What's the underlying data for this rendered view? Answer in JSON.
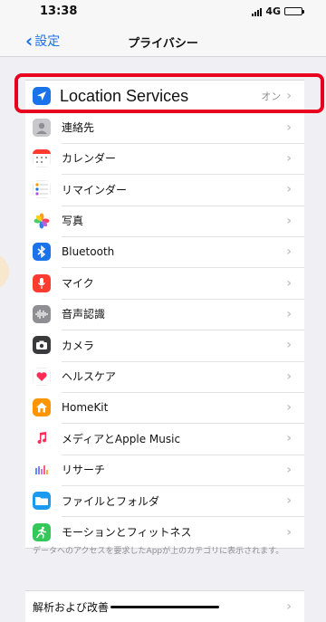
{
  "status": {
    "time": "13:38",
    "network": "4G"
  },
  "nav": {
    "back_label": "設定",
    "title": "プライバシー"
  },
  "rows": [
    {
      "label": "Location Services",
      "value": "オン",
      "icon": "location-arrow-icon",
      "color": "#1a73e8"
    },
    {
      "label": "連絡先",
      "value": "",
      "icon": "contacts-icon",
      "color": "#a8a8ad"
    },
    {
      "label": "カレンダー",
      "value": "",
      "icon": "calendar-icon",
      "color": "#ffffff"
    },
    {
      "label": "リマインダー",
      "value": "",
      "icon": "reminders-icon",
      "color": "#ffffff"
    },
    {
      "label": "写真",
      "value": "",
      "icon": "photos-icon",
      "color": "#ffffff"
    },
    {
      "label": "Bluetooth",
      "value": "",
      "icon": "bluetooth-icon",
      "color": "#1a73e8"
    },
    {
      "label": "マイク",
      "value": "",
      "icon": "microphone-icon",
      "color": "#ff3b30"
    },
    {
      "label": "音声認識",
      "value": "",
      "icon": "speech-recognition-icon",
      "color": "#8e8e93"
    },
    {
      "label": "カメラ",
      "value": "",
      "icon": "camera-icon",
      "color": "#3a3a3c"
    },
    {
      "label": "ヘルスケア",
      "value": "",
      "icon": "health-heart-icon",
      "color": "#ffffff"
    },
    {
      "label": "HomeKit",
      "value": "",
      "icon": "homekit-icon",
      "color": "#ff9500"
    },
    {
      "label": "メディアとApple Music",
      "value": "",
      "icon": "music-note-icon",
      "color": "#ffffff"
    },
    {
      "label": "リサーチ",
      "value": "",
      "icon": "research-icon",
      "color": "#ffffff"
    },
    {
      "label": "ファイルとフォルダ",
      "value": "",
      "icon": "folder-icon",
      "color": "#1a9bf0"
    },
    {
      "label": "モーションとフィットネス",
      "value": "",
      "icon": "fitness-runner-icon",
      "color": "#34c759"
    }
  ],
  "footer_note": "データへのアクセスを要求したAppが上のカテゴリに表示されます。",
  "analysis_label": "解析および改善"
}
